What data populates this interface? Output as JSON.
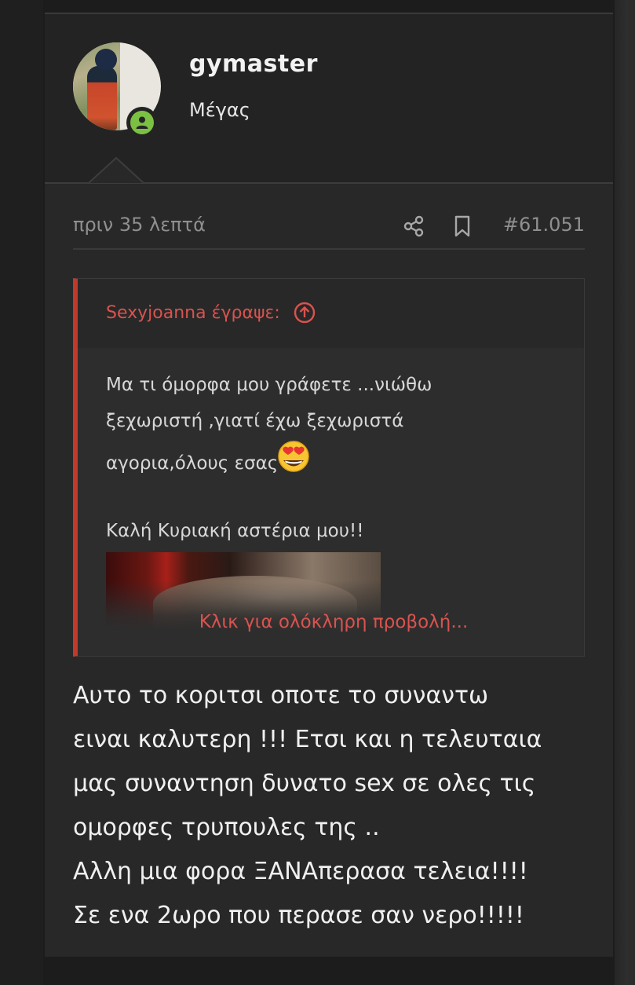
{
  "user": {
    "username": "gymaster",
    "title": "Μέγας",
    "status": "online"
  },
  "meta": {
    "time": "πριν 35 λεπτά",
    "post_number": "#61.051"
  },
  "quote": {
    "author": "Sexyjoanna έγραψε:",
    "lines": [
      "Μα τι όμορφα μου γράφετε ...νιώθω",
      "ξεχωριστή ,γιατί έχω ξεχωριστά",
      "αγορια,όλους εσας"
    ],
    "emoji": "smiling-face-with-heart-eyes",
    "greeting": "Καλή Κυριακή αστέρια μου!!",
    "expand_label": "Κλικ για ολόκληρη προβολή..."
  },
  "post": {
    "lines": [
      "Αυτο το κοριτσι οποτε το συναντω",
      "ειναι καλυτερη !!! Ετσι και η τελευταια",
      "μας συναντηση δυνατο sex σε ολες τις",
      "ομορφες τρυπουλες της ..",
      "Αλλη μια φορα ΞΑΝΑπερασα τελεια!!!!",
      "Σε ενα 2ωρο που περασε σαν νερο!!!!!"
    ]
  },
  "colors": {
    "accent": "#d9534f",
    "quote_border": "#c0392b",
    "online": "#7bc043",
    "muted": "#8f8f8f"
  }
}
